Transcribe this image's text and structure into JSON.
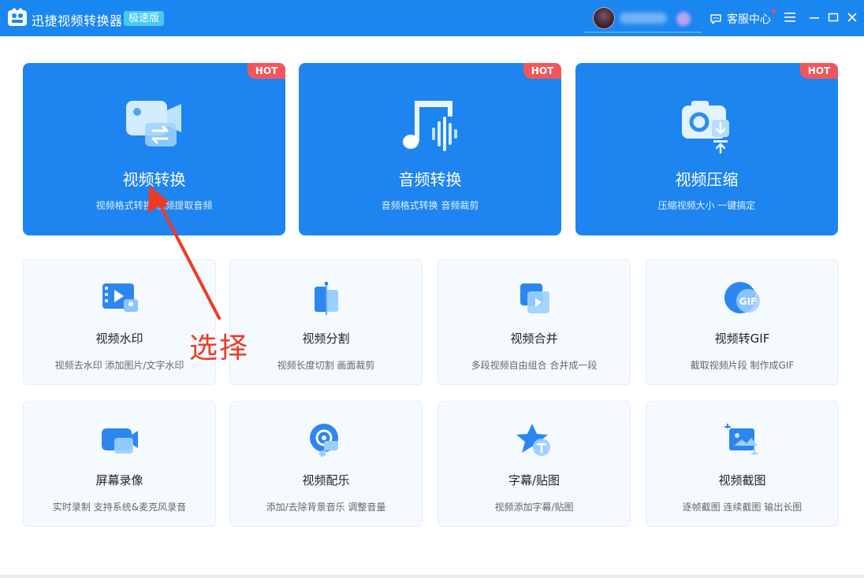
{
  "app": {
    "title": "迅捷视频转换器",
    "edition": "极速版",
    "support_label": "客服中心"
  },
  "colors": {
    "titlebar": "#1a86f0",
    "hot_card": "#1d84f0",
    "hot_badge": "#f2565a",
    "annotation": "#ef3b24"
  },
  "hot_cards": [
    {
      "icon": "video-convert-icon",
      "badge": "HOT",
      "title": "视频转换",
      "desc": "视频格式转换 视频提取音频"
    },
    {
      "icon": "music-note-icon",
      "badge": "HOT",
      "title": "音频转换",
      "desc": "音频格式转换 音频裁剪"
    },
    {
      "icon": "compress-icon",
      "badge": "HOT",
      "title": "视频压缩",
      "desc": "压缩视频大小 一键搞定"
    }
  ],
  "tools": [
    {
      "icon": "watermark-icon",
      "title": "视频水印",
      "desc": "视频去水印 添加图片/文字水印"
    },
    {
      "icon": "split-icon",
      "title": "视频分割",
      "desc": "视频长度切割 画面裁剪"
    },
    {
      "icon": "merge-icon",
      "title": "视频合并",
      "desc": "多段视频自由组合 合并成一段"
    },
    {
      "icon": "gif-icon",
      "title": "视频转GIF",
      "desc": "截取视频片段 制作成GIF"
    },
    {
      "icon": "screen-record-icon",
      "title": "屏幕录像",
      "desc": "实时录制 支持系统&麦克风录音"
    },
    {
      "icon": "music-disc-icon",
      "title": "视频配乐",
      "desc": "添加/去除背景音乐 调整音量"
    },
    {
      "icon": "subtitle-star-icon",
      "title": "字幕/贴图",
      "desc": "视频添加字幕/贴图"
    },
    {
      "icon": "screenshot-icon",
      "title": "视频截图",
      "desc": "逐帧截图 连续截图 输出长图"
    }
  ],
  "annotation": {
    "text": "选择"
  }
}
